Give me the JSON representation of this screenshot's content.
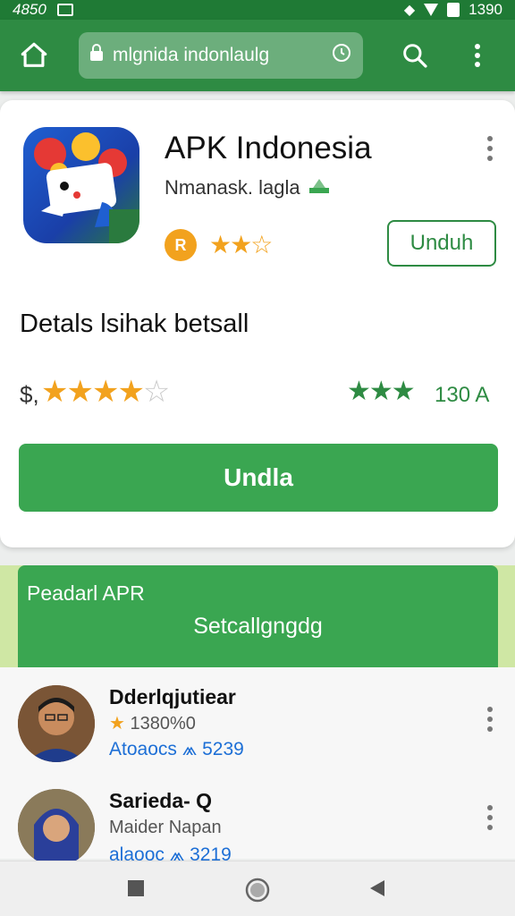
{
  "status_bar": {
    "time_left": "4850",
    "time_right": "1390"
  },
  "browser": {
    "url": "mlgnida indonlaulg",
    "icons": [
      "home-icon",
      "lock-icon",
      "clock-icon",
      "search-icon",
      "more-vert-icon"
    ]
  },
  "app": {
    "title": "APK Indonesia",
    "developer": "Nmanask. lagla",
    "badge": "R",
    "stars_display": "★★☆",
    "install_label": "Unduh"
  },
  "details": {
    "title": "Detals lsihak betsall",
    "price_symbol": "$,",
    "rating": 4,
    "rating_max": 5,
    "stars_full": "★★★★",
    "stars_empty": "☆",
    "green_stars": "★★★",
    "count": "130 A",
    "install_label": "Undla"
  },
  "banner": {
    "label": "Peadarl APR",
    "subtitle": "Setcallgngdg"
  },
  "list": [
    {
      "name": "Dderlqjutiear",
      "meta": "1380%0",
      "stats": "Atoaocs  ⩕  5239"
    },
    {
      "name": "Sarieda- Q",
      "meta": "Maider Napan",
      "stats": "alaooc ⩕ 3219"
    }
  ],
  "colors": {
    "primary": "#2e8b43",
    "primary_light": "#3aa651",
    "accent": "#f2a21e",
    "link": "#1d6fd6"
  }
}
